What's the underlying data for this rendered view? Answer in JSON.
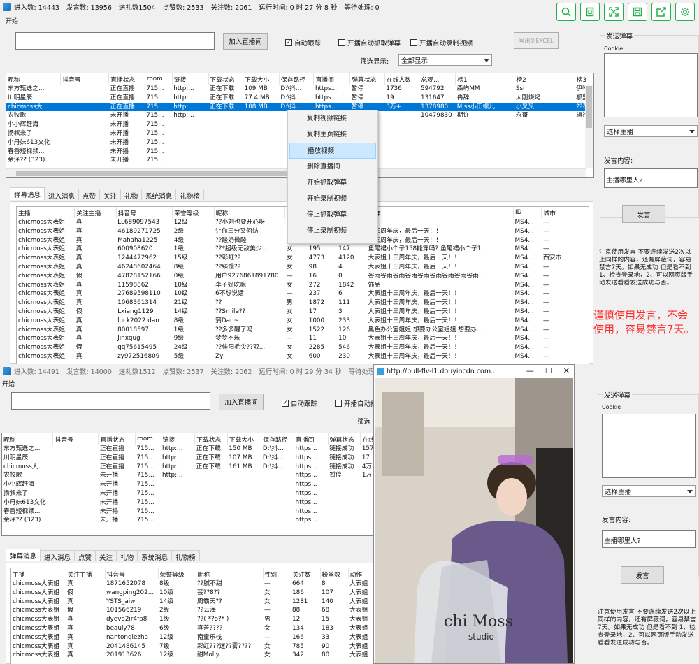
{
  "w1": {
    "status": [
      "进入数: 14443",
      "发言数: 13956",
      "送礼数1504",
      "点赞数: 2533",
      "关注数: 2061",
      "运行时间: 0 时 27 分 8 秒",
      "等待处理: 0"
    ],
    "menu": "开始",
    "add_room_btn": "加入直播间",
    "auto_track": "自动跟踪",
    "auto_grab_danmu": "开播自动抓取弹幕",
    "auto_record": "开播自动录制视频",
    "export_btn": "导出到EXCEL",
    "filter_label": "筛选显示:",
    "filter_value": "全部显示",
    "rooms_headers": [
      "昵称",
      "抖音号",
      "直播状态",
      "room",
      "链接",
      "下载状态",
      "下载大小",
      "保存路径",
      "直播间",
      "弹幕状态",
      "在线人数",
      "总观...",
      "榜1",
      "榜2",
      "榜3"
    ],
    "rooms": [
      [
        "东方甄选之...",
        "",
        "正在直播",
        "715...",
        "http:...",
        "正在下载",
        "109 MB",
        "D:\\抖...",
        "https...",
        "暂停",
        "1736",
        "594792",
        "森屿MM",
        "Ssi",
        "伊叶"
      ],
      [
        "川明星辰",
        "",
        "正在直播",
        "715...",
        "http:...",
        "正在下载",
        "77.4 MB",
        "D:\\抖...",
        "https...",
        "暂停",
        "19",
        "131647",
        "冉辞",
        "大刚烧烤",
        "郝里个郎"
      ],
      [
        "chicmoss大...",
        "",
        "正在直播",
        "715...",
        "http:...",
        "正在下载",
        "108 MB",
        "D:\\抖...",
        "https...",
        "暂停",
        "3万+",
        "1378980",
        "Miss小田螺儿",
        "小叉叉",
        "??花下人"
      ],
      [
        "农牧歌",
        "",
        "未开播",
        "715...",
        "http:...",
        "",
        "",
        "",
        "",
        "",
        "",
        "10479830",
        "期许i",
        "永哥",
        "旗袍一姐"
      ],
      [
        "小小辉赶海",
        "",
        "未开播",
        "715...",
        "",
        "",
        "",
        "",
        "",
        "",
        "",
        "",
        "",
        "",
        ""
      ],
      [
        "扬叔来了",
        "",
        "未开播",
        "715...",
        "",
        "",
        "",
        "",
        "",
        "",
        "",
        "",
        "",
        "",
        ""
      ],
      [
        "小丹妹613文化",
        "",
        "未开播",
        "715...",
        "",
        "",
        "",
        "",
        "",
        "",
        "",
        "",
        "",
        "",
        ""
      ],
      [
        "春香短视频...",
        "",
        "未开播",
        "715...",
        "",
        "",
        "",
        "",
        "",
        "",
        "",
        "",
        "",
        "",
        ""
      ],
      [
        "余泽?? (323)",
        "",
        "未开播",
        "715...",
        "",
        "",
        "",
        "",
        "",
        "",
        "",
        "",
        "",
        "",
        ""
      ]
    ],
    "tabs": [
      "弹幕消息",
      "进入消息",
      "点赞",
      "关注",
      "礼物",
      "系统消息",
      "礼物榜"
    ],
    "danmu_headers": [
      "主播",
      "关注主播",
      "抖音号",
      "荣誉等级",
      "昵称",
      "性别",
      "关注数",
      "粉丝数",
      "动作",
      "ID",
      "城市"
    ],
    "danmu": [
      [
        "chicmoss大表姐",
        "真",
        "LL689097543",
        "12级",
        "??小刘也要开心呀",
        "女",
        "",
        "",
        "",
        "MS4...",
        "—"
      ],
      [
        "chicmoss大表姐",
        "真",
        "46189271725",
        "2级",
        "让你三分又何妨",
        "女",
        "",
        "",
        "十三周年庆，最后一天！！",
        "MS4...",
        "—"
      ],
      [
        "chicmoss大表姐",
        "真",
        "Mahaha1225",
        "4级",
        "??酸奶微酸",
        "女",
        "",
        "",
        "十三周年庆，最后一天！！",
        "MS4...",
        "—"
      ],
      [
        "chicmoss大表姐",
        "真",
        "600908620",
        "1级",
        "??*超级无敌美少...",
        "女",
        "195",
        "147",
        "鱼尾裙小个子158能穿吗? 鱼尾裙小个子1...",
        "MS4...",
        "—"
      ],
      [
        "chicmoss大表姐",
        "真",
        "1244472962",
        "15级",
        "??彩虹??",
        "女",
        "4773",
        "4120",
        "大表姐十三周年庆，最后一天！！",
        "MS4...",
        "西安市"
      ],
      [
        "chicmoss大表姐",
        "真",
        "46248602464",
        "8级",
        "??臻馒??",
        "女",
        "98",
        "4",
        "大表姐十三周年庆，最后一天！！",
        "MS4...",
        "—"
      ],
      [
        "chicmoss大表姐",
        "假",
        "47828152166",
        "0级",
        "用户9276861891780",
        "—",
        "16",
        "0",
        "谷雨谷雨谷雨谷雨谷雨谷雨谷雨谷雨谷雨...",
        "MS4...",
        "—"
      ],
      [
        "chicmoss大表姐",
        "真",
        "11598862",
        "10级",
        "李子好吃嘛",
        "女",
        "272",
        "1842",
        "饰品",
        "MS4...",
        "—"
      ],
      [
        "chicmoss大表姐",
        "真",
        "27689598110",
        "10级",
        "6不想说话",
        "—",
        "237",
        "6",
        "大表姐十三周年庆，最后一天！！",
        "MS4...",
        "—"
      ],
      [
        "chicmoss大表姐",
        "真",
        "1068361314",
        "21级",
        "??",
        "男",
        "1872",
        "111",
        "大表姐十三周年庆，最后一天！！",
        "MS4...",
        "—"
      ],
      [
        "chicmoss大表姐",
        "假",
        "Lxiang1129",
        "14级",
        "??Smile??",
        "女",
        "17",
        "3",
        "大表姐十三周年庆，最后一天！！",
        "MS4...",
        "—"
      ],
      [
        "chicmoss大表姐",
        "真",
        "luck2022.dan",
        "8级",
        "蒲Dan~",
        "女",
        "1000",
        "233",
        "大表姐十三周年庆，最后一天！！",
        "MS4...",
        "—"
      ],
      [
        "chicmoss大表姐",
        "真",
        "80018597",
        "1级",
        "??多多醒了吗",
        "女",
        "1522",
        "126",
        "黑色办公室姐姐 想要办公室姐姐 想要办...",
        "MS4...",
        "—"
      ],
      [
        "chicmoss大表姐",
        "真",
        "Jinxqug",
        "9级",
        "梦梦不乐",
        "—",
        "11",
        "10",
        "大表姐十三周年庆，最后一天！！",
        "MS4...",
        "—"
      ],
      [
        "chicmoss大表姐",
        "假",
        "qq75615495",
        "24级",
        "??佳阳毛尖??双...",
        "女",
        "2285",
        "546",
        "大表姐十三周年庆，最后一天！！",
        "MS4...",
        "—"
      ],
      [
        "chicmoss大表姐",
        "真",
        "zy972516809",
        "5级",
        "Zy",
        "女",
        "600",
        "230",
        "大表姐十三周年庆，最后一天！！",
        "MS4...",
        "—"
      ]
    ],
    "ctx_menu": [
      "复制视频链接",
      "复制主页链接",
      "播放视频",
      "删除直播间",
      "开始抓取弹幕",
      "开始录制视频",
      "停止抓取弹幕",
      "停止录制视频"
    ],
    "send_group": "发送弹幕",
    "cookie_label": "Cookie",
    "select_anchor": "选择主播",
    "speech_label": "发言内容:",
    "speech_value": "主播哪里人?",
    "speak_btn": "发言",
    "note": "注意使用发言 不要连续发送2次以上同样的内容，还有屏蔽词，容易禁言7天。如果无成功 但是看不到 1、检查登录地，2、可以网页版手动发送看看发送成功与否。",
    "warn": "谨慎使用发言，不会使用，容易禁言7天。"
  },
  "w2": {
    "status": [
      "进入数: 14491",
      "发言数: 14000",
      "送礼数1512",
      "点赞数: 2537",
      "关注数: 2062",
      "运行时间: 0 时 29 分 34 秒",
      "等待处理: 0"
    ],
    "menu": "开始",
    "add_room_btn": "加入直播间",
    "auto_track": "自动跟踪",
    "auto_grab_danmu": "开播自动抓",
    "filter_label": "筛选",
    "rooms_headers": [
      "昵称",
      "抖音号",
      "直播状态",
      "room",
      "链接",
      "下载状态",
      "下载大小",
      "保存路径",
      "直播间",
      "弹幕状态",
      "在线"
    ],
    "rooms": [
      [
        "东方甄选之...",
        "",
        "正在直播",
        "715...",
        "http:...",
        "正在下载",
        "150 MB",
        "D:\\抖...",
        "https...",
        "链接成功",
        "1577"
      ],
      [
        "川明星辰",
        "",
        "正在直播",
        "715...",
        "http:...",
        "正在下载",
        "107 MB",
        "D:\\抖...",
        "https...",
        "链接成功",
        "17"
      ],
      [
        "chicmoss大...",
        "",
        "正在直播",
        "715...",
        "http:...",
        "正在下载",
        "161 MB",
        "D:\\抖...",
        "https...",
        "链接成功",
        "4万+"
      ],
      [
        "农牧歌",
        "",
        "未开播",
        "715...",
        "http:...",
        "",
        "",
        "",
        "https...",
        "暂停",
        "1万+"
      ],
      [
        "小小辉赶海",
        "",
        "未开播",
        "715...",
        "",
        "",
        "",
        "",
        "https...",
        "",
        ""
      ],
      [
        "扬叔来了",
        "",
        "未开播",
        "715...",
        "",
        "",
        "",
        "",
        "https...",
        "",
        ""
      ],
      [
        "小丹妹613文化",
        "",
        "未开播",
        "715...",
        "",
        "",
        "",
        "",
        "https...",
        "",
        ""
      ],
      [
        "春香短视频...",
        "",
        "未开播",
        "715...",
        "",
        "",
        "",
        "",
        "https...",
        "",
        ""
      ],
      [
        "余泽?? (323)",
        "",
        "未开播",
        "715...",
        "",
        "",
        "",
        "",
        "https...",
        "",
        ""
      ]
    ],
    "tabs": [
      "弹幕消息",
      "进入消息",
      "点赞",
      "关注",
      "礼物",
      "系统消息",
      "礼物榜"
    ],
    "danmu_headers": [
      "主播",
      "关注主播",
      "抖音号",
      "荣誉等级",
      "昵称",
      "性别",
      "关注数",
      "粉丝数",
      "动作"
    ],
    "danmu": [
      [
        "chicmoss大表姐",
        "真",
        "1871652078",
        "8级",
        "??腻不甜",
        "—",
        "664",
        "8",
        "大表姐"
      ],
      [
        "chicmoss大表姐",
        "假",
        "wangping202...",
        "10级",
        "芸??8??",
        "女",
        "186",
        "107",
        "大表姐"
      ],
      [
        "chicmoss大表姐",
        "真",
        "YSTS_aiw",
        "14级",
        "周霸天??",
        "女",
        "1281",
        "140",
        "大表姐"
      ],
      [
        "chicmoss大表姐",
        "假",
        "101566219",
        "2级",
        "??云海",
        "—",
        "88",
        "68",
        "大表姐"
      ],
      [
        "chicmoss大表姐",
        "真",
        "dyeve2ir4fp8",
        "1级",
        "??( *?o?* )",
        "男",
        "12",
        "15",
        "大表姐"
      ],
      [
        "chicmoss大表姐",
        "真",
        "beauly78",
        "6级",
        "真善????",
        "女",
        "134",
        "183",
        "大表姐"
      ],
      [
        "chicmoss大表姐",
        "真",
        "nantonglezha",
        "12级",
        "南童乐栈",
        "—",
        "166",
        "33",
        "大表姐"
      ],
      [
        "chicmoss大表姐",
        "真",
        "2041486145",
        "7级",
        "彩虹???迷??雾????",
        "女",
        "785",
        "90",
        "大表姐"
      ],
      [
        "chicmoss大表姐",
        "真",
        "201913626",
        "12级",
        "甜Molly.",
        "女",
        "342",
        "80",
        "大表姐"
      ]
    ],
    "send_group": "发送弹幕",
    "cookie_label": "Cookie",
    "select_anchor": "选择主播",
    "speech_label": "发言内容:",
    "speech_value": "主播哪里人?",
    "speak_btn": "发言",
    "note": "注意使用发言 不要连续发送2次以上同样的内容，还有屏蔽词，容易禁言7天。如果无成功 但是看不到 1、检查登录地，2、可以网页版手动发送看看发送成功与否。"
  },
  "player": {
    "title": "http://pull-flv-l1.douyincdn.com...",
    "minimize": "—",
    "maximize": "☐",
    "close": "✕",
    "bag_text_1": "chi Moss",
    "bag_text_2": "studio"
  },
  "toolbar_icons": [
    "zoom-icon",
    "copy-icon",
    "expand-icon",
    "save-icon",
    "share-icon",
    "settings-icon"
  ],
  "colors": {
    "selected_row": "#0078d7",
    "warn_text": "#ff2a2a",
    "toolbar_border": "#22b14c"
  }
}
